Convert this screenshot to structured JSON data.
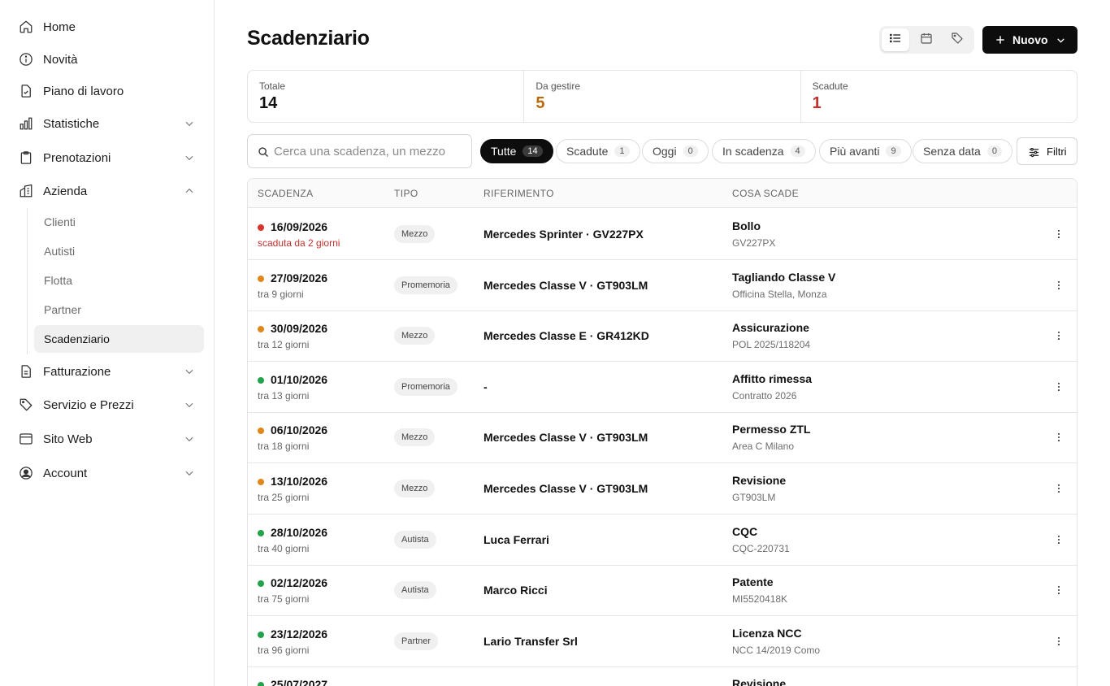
{
  "sidebar": {
    "items": [
      {
        "label": "Home",
        "icon": "home-icon"
      },
      {
        "label": "Novità",
        "icon": "info-icon"
      },
      {
        "label": "Piano di lavoro",
        "icon": "file-check-icon"
      },
      {
        "label": "Statistiche",
        "icon": "bar-chart-icon"
      },
      {
        "label": "Prenotazioni",
        "icon": "clipboard-icon"
      },
      {
        "label": "Azienda",
        "icon": "building-icon"
      },
      {
        "label": "Fatturazione",
        "icon": "invoice-icon"
      },
      {
        "label": "Servizio e Prezzi",
        "icon": "tag-icon"
      },
      {
        "label": "Sito Web",
        "icon": "browser-icon"
      },
      {
        "label": "Account",
        "icon": "user-circle-icon"
      }
    ],
    "azienda_sub": [
      {
        "label": "Clienti"
      },
      {
        "label": "Autisti"
      },
      {
        "label": "Flotta"
      },
      {
        "label": "Partner"
      },
      {
        "label": "Scadenziario"
      }
    ]
  },
  "header": {
    "title": "Scadenziario",
    "new_label": "Nuovo"
  },
  "stats": [
    {
      "label": "Totale",
      "value": "14",
      "color": "#111111"
    },
    {
      "label": "Da gestire",
      "value": "5",
      "color": "#b86a0c"
    },
    {
      "label": "Scadute",
      "value": "1",
      "color": "#c4302b"
    }
  ],
  "search": {
    "placeholder": "Cerca una scadenza, un mezzo"
  },
  "chips": [
    {
      "label": "Tutte",
      "count": "14"
    },
    {
      "label": "Scadute",
      "count": "1"
    },
    {
      "label": "Oggi",
      "count": "0"
    },
    {
      "label": "In scadenza",
      "count": "4"
    },
    {
      "label": "Più avanti",
      "count": "9"
    },
    {
      "label": "Senza data",
      "count": "0"
    }
  ],
  "filter_label": "Filtri",
  "table": {
    "headers": {
      "scadenza": "SCADENZA",
      "tipo": "TIPO",
      "riferimento": "RIFERIMENTO",
      "cosa": "COSA SCADE"
    },
    "rows": [
      {
        "date": "16/09/2026",
        "rel": "scaduta da 2 giorni",
        "status_color": "#d9342b",
        "tipo": "Mezzo",
        "ref": "Mercedes Sprinter · GV227PX",
        "what": "Bollo",
        "what_sub": "GV227PX"
      },
      {
        "date": "27/09/2026",
        "rel": "tra 9 giorni",
        "status_color": "#e0861a",
        "tipo": "Promemoria",
        "ref": "Mercedes Classe V · GT903LM",
        "what": "Tagliando Classe V",
        "what_sub": "Officina Stella, Monza"
      },
      {
        "date": "30/09/2026",
        "rel": "tra 12 giorni",
        "status_color": "#e0861a",
        "tipo": "Mezzo",
        "ref": "Mercedes Classe E · GR412KD",
        "what": "Assicurazione",
        "what_sub": "POL 2025/118204"
      },
      {
        "date": "01/10/2026",
        "rel": "tra 13 giorni",
        "status_color": "#22a24a",
        "tipo": "Promemoria",
        "ref": "-",
        "what": "Affitto rimessa",
        "what_sub": "Contratto 2026"
      },
      {
        "date": "06/10/2026",
        "rel": "tra 18 giorni",
        "status_color": "#e0861a",
        "tipo": "Mezzo",
        "ref": "Mercedes Classe V · GT903LM",
        "what": "Permesso ZTL",
        "what_sub": "Area C Milano"
      },
      {
        "date": "13/10/2026",
        "rel": "tra 25 giorni",
        "status_color": "#e0861a",
        "tipo": "Mezzo",
        "ref": "Mercedes Classe V · GT903LM",
        "what": "Revisione",
        "what_sub": "GT903LM"
      },
      {
        "date": "28/10/2026",
        "rel": "tra 40 giorni",
        "status_color": "#22a24a",
        "tipo": "Autista",
        "ref": "Luca Ferrari",
        "what": "CQC",
        "what_sub": "CQC-220731"
      },
      {
        "date": "02/12/2026",
        "rel": "tra 75 giorni",
        "status_color": "#22a24a",
        "tipo": "Autista",
        "ref": "Marco Ricci",
        "what": "Patente",
        "what_sub": "MI5520418K"
      },
      {
        "date": "23/12/2026",
        "rel": "tra 96 giorni",
        "status_color": "#22a24a",
        "tipo": "Partner",
        "ref": "Lario Transfer Srl",
        "what": "Licenza NCC",
        "what_sub": "NCC 14/2019 Como"
      },
      {
        "date": "25/07/2027",
        "rel": "",
        "status_color": "#22a24a",
        "tipo": "",
        "ref": "",
        "what": "Revisione",
        "what_sub": ""
      }
    ]
  }
}
